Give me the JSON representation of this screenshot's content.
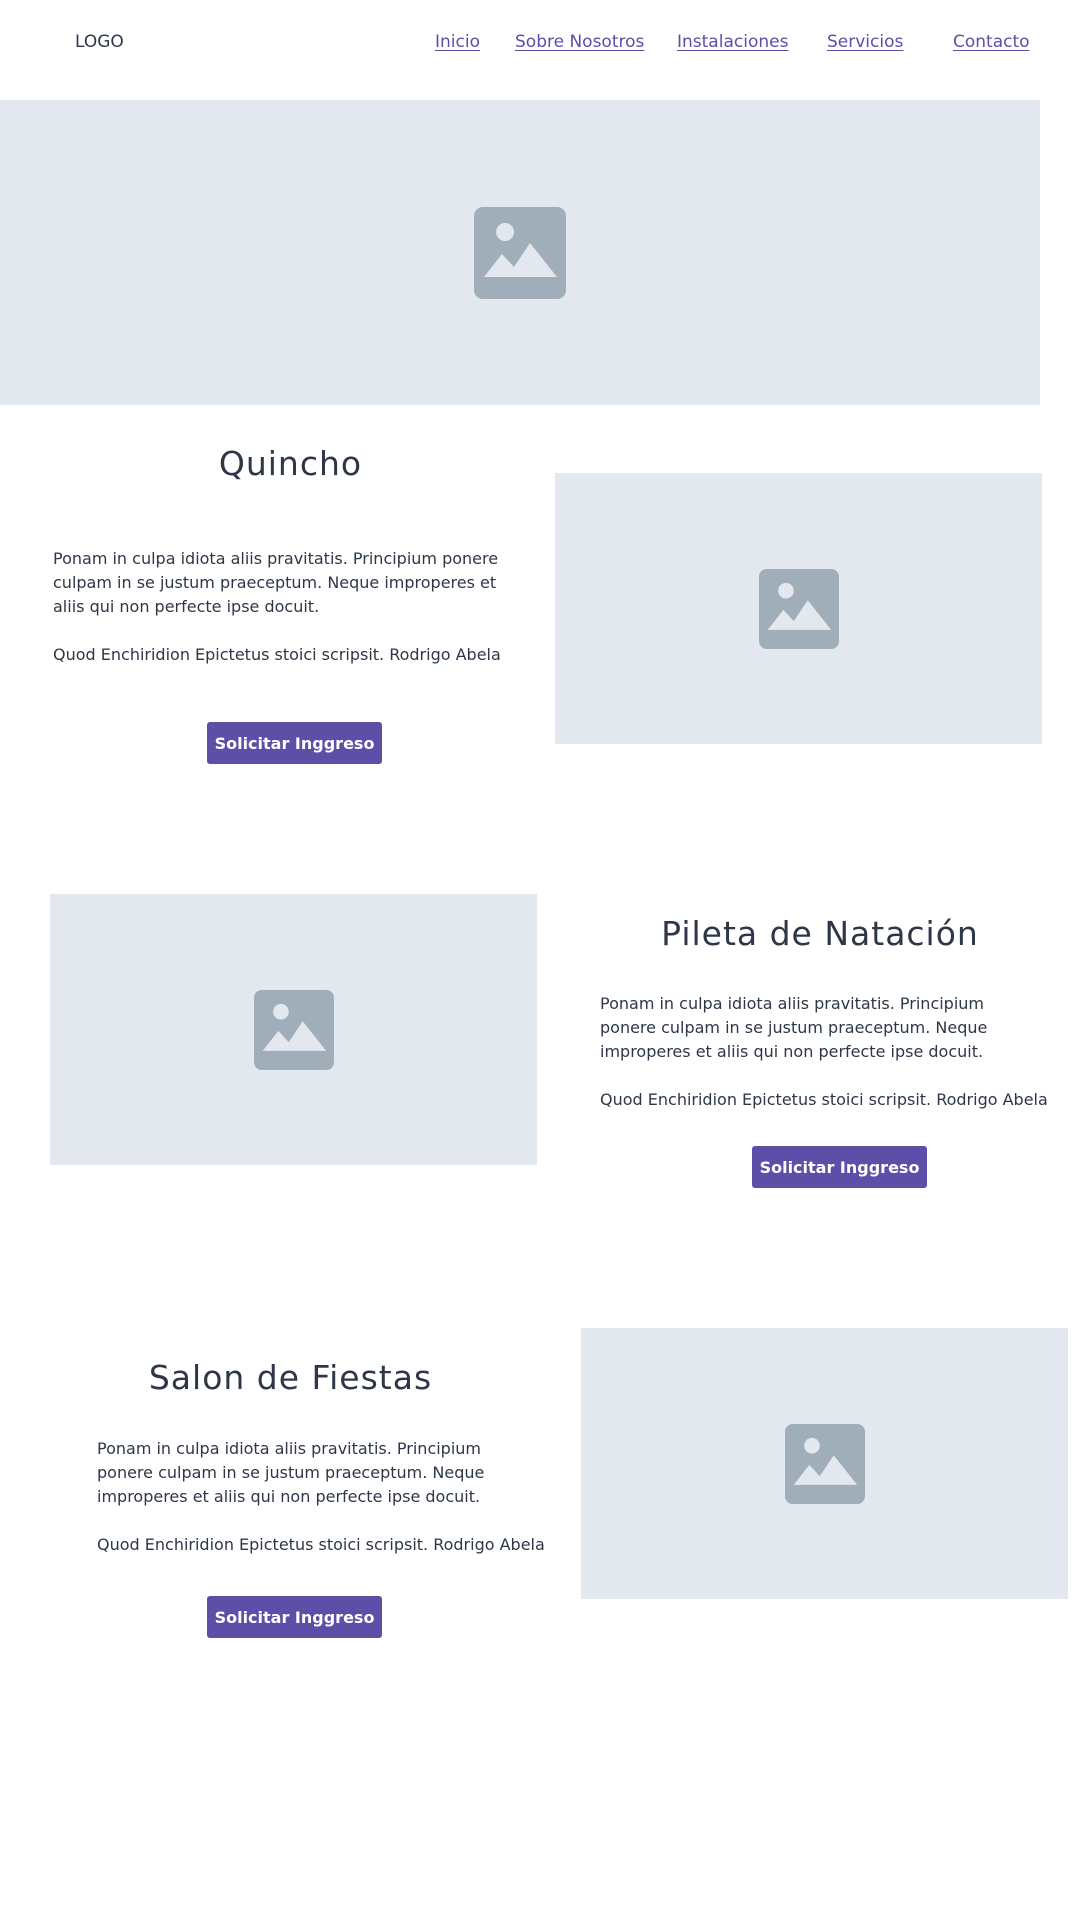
{
  "header": {
    "logo": "LOGO",
    "nav": [
      "Inicio",
      "Sobre Nosotros",
      "Instalaciones",
      "Servicios",
      "Contacto"
    ]
  },
  "colors": {
    "accent": "#5b4fa8",
    "placeholder_bg": "#e2e8ed",
    "placeholder_icon": "#a0aeba",
    "text": "#2d3748"
  },
  "hero": {
    "icon": "image-placeholder-icon"
  },
  "sections": [
    {
      "title": "Quincho",
      "paragraph1": "Ponam in culpa idiota aliis pravitatis. Principium ponere culpam in se justum praeceptum. Neque improperes et aliis qui non perfecte ipse docuit.",
      "paragraph2": "Quod Enchiridion Epictetus stoici scripsit. Rodrigo Abela",
      "button": "Solicitar Inggreso"
    },
    {
      "title": "Pileta de Natación",
      "paragraph1": "Ponam in culpa idiota aliis pravitatis. Principium ponere culpam in se justum praeceptum. Neque improperes et aliis qui non perfecte ipse docuit.",
      "paragraph2": "Quod Enchiridion Epictetus stoici scripsit. Rodrigo Abela",
      "button": "Solicitar Inggreso"
    },
    {
      "title": "Salon de Fiestas",
      "paragraph1": "Ponam in culpa idiota aliis pravitatis. Principium ponere culpam in se justum praeceptum. Neque improperes et aliis qui non perfecte ipse docuit.",
      "paragraph2": "Quod Enchiridion Epictetus stoici scripsit. Rodrigo Abela",
      "button": "Solicitar Inggreso"
    }
  ]
}
